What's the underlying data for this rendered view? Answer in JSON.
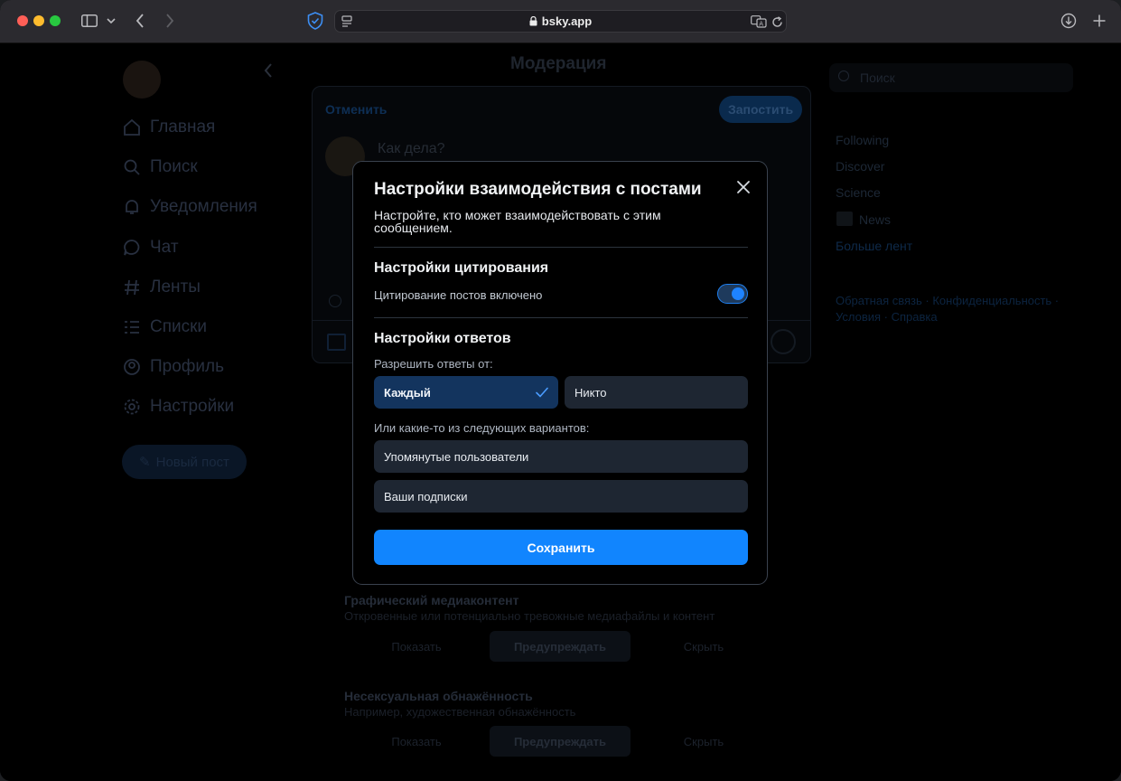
{
  "browser": {
    "url": "bsky.app"
  },
  "background": {
    "page_title": "Модерация",
    "composer_cancel": "Отменить",
    "composer_post": "Запостить",
    "composer_placeholder": "Как дела?",
    "nav": [
      "Главная",
      "Поиск",
      "Уведомления",
      "Чат",
      "Ленты",
      "Списки",
      "Профиль",
      "Настройки"
    ],
    "new_post": "Новый пост",
    "search_placeholder": "Поиск",
    "feeds": [
      "Following",
      "Discover",
      "Science",
      "News",
      "Больше лент"
    ],
    "footer_links": "Обратная связь · Конфиденциальность · Условия · Справка",
    "mod_sections": [
      {
        "title": "Графический медиаконтент",
        "desc": "Откровенные или потенциально тревожные медиафайлы и контент",
        "options": [
          "Показать",
          "Предупреждать",
          "Скрыть"
        ]
      },
      {
        "title": "Несексуальная обнажённость",
        "desc": "Например, художественная обнажённость",
        "options": [
          "Показать",
          "Предупреждать",
          "Скрыть"
        ]
      }
    ]
  },
  "modal": {
    "title": "Настройки взаимодействия с постами",
    "subtitle": "Настройте, кто может взаимодействовать с этим сообщением.",
    "quote_section": {
      "title": "Настройки цитирования",
      "toggle_label": "Цитирование постов включено",
      "enabled": true
    },
    "reply_section": {
      "title": "Настройки ответов",
      "allow_label": "Разрешить ответы от:",
      "everyone": "Каждый",
      "nobody": "Никто",
      "or_label": "Или какие-то из следующих вариантов:",
      "mentioned": "Упомянутые пользователи",
      "following": "Ваши подписки"
    },
    "save_label": "Сохранить"
  },
  "colors": {
    "accent": "#1185fe",
    "selected_option": "#13345e",
    "option_bg": "#1e2632"
  }
}
